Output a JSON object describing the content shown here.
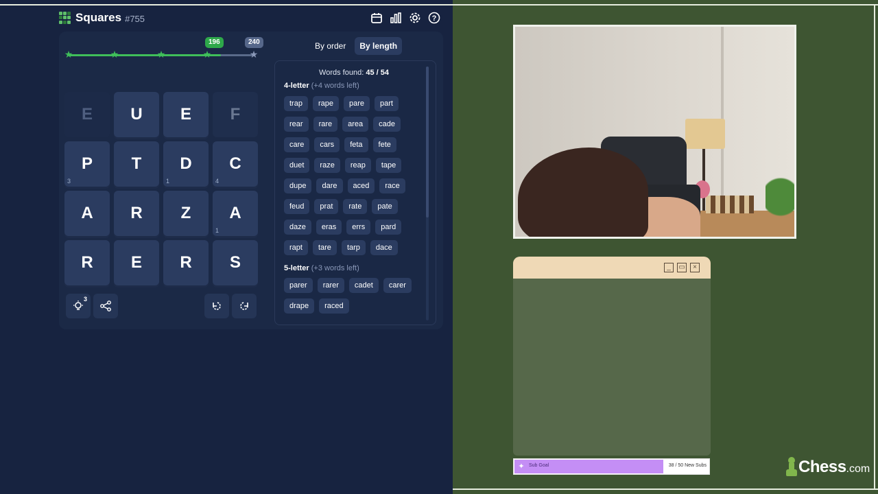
{
  "game": {
    "title": "Squares",
    "puzzle_number": "#755",
    "header_icons": [
      "calendar-icon",
      "stats-icon",
      "settings-icon",
      "help-icon"
    ],
    "progress": {
      "current_score": "196",
      "max_score": "240",
      "fraction": 0.817,
      "stars_reached": 4,
      "stars_total": 5
    },
    "grid": [
      [
        {
          "letter": "E",
          "count": "",
          "state": "faded"
        },
        {
          "letter": "U",
          "count": "",
          "state": "active"
        },
        {
          "letter": "E",
          "count": "",
          "state": "active"
        },
        {
          "letter": "F",
          "count": "",
          "state": "faded2"
        }
      ],
      [
        {
          "letter": "P",
          "count": "3",
          "state": "active"
        },
        {
          "letter": "T",
          "count": "",
          "state": "active"
        },
        {
          "letter": "D",
          "count": "1",
          "state": "active"
        },
        {
          "letter": "C",
          "count": "4",
          "state": "active"
        }
      ],
      [
        {
          "letter": "A",
          "count": "",
          "state": "active"
        },
        {
          "letter": "R",
          "count": "",
          "state": "active"
        },
        {
          "letter": "Z",
          "count": "",
          "state": "active"
        },
        {
          "letter": "A",
          "count": "1",
          "state": "active"
        }
      ],
      [
        {
          "letter": "R",
          "count": "",
          "state": "active"
        },
        {
          "letter": "E",
          "count": "",
          "state": "active"
        },
        {
          "letter": "R",
          "count": "",
          "state": "active"
        },
        {
          "letter": "S",
          "count": "",
          "state": "active"
        }
      ]
    ],
    "hints_count": "3",
    "tool_buttons": [
      "hint-icon",
      "share-icon",
      "rotate-left-icon",
      "rotate-right-icon"
    ]
  },
  "words": {
    "tab_by_order": "By order",
    "tab_by_length": "By length",
    "found_label": "Words found:",
    "found_value": "45 / 54",
    "sections": [
      {
        "title": "4-letter",
        "left": "(+4 words left)",
        "words": [
          "trap",
          "rape",
          "pare",
          "part",
          "rear",
          "rare",
          "area",
          "cade",
          "care",
          "cars",
          "feta",
          "fete",
          "duet",
          "raze",
          "reap",
          "tape",
          "dupe",
          "dare",
          "aced",
          "race",
          "feud",
          "prat",
          "rate",
          "pate",
          "daze",
          "eras",
          "errs",
          "pard",
          "rapt",
          "tare",
          "tarp",
          "dace"
        ]
      },
      {
        "title": "5-letter",
        "left": "(+3 words left)",
        "words": [
          "parer",
          "rarer",
          "cadet",
          "carer",
          "drape",
          "raced"
        ]
      }
    ]
  },
  "stream": {
    "subgoal_label": "Sub Goal",
    "subgoal_count": "38 / 50 New Subs",
    "subgoal_fraction": 0.76,
    "logo_text": "Chess",
    "logo_suffix": ".com"
  }
}
